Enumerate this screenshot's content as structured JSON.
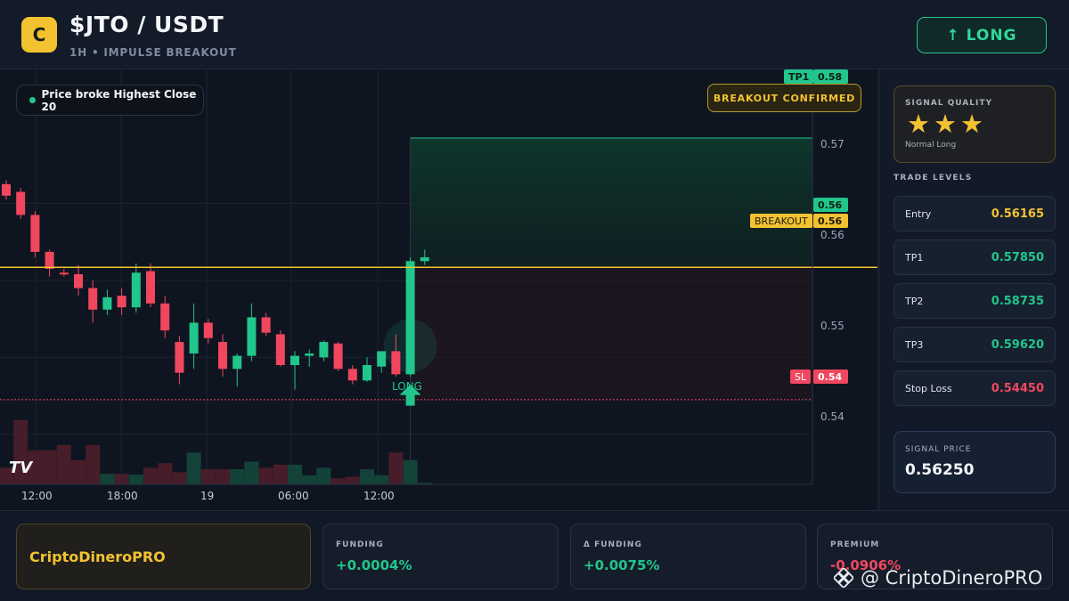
{
  "header": {
    "logo_letter": "C",
    "title": "$JTO / USDT",
    "subtitle": "1H • IMPULSE BREAKOUT",
    "long_button": "↑ LONG"
  },
  "chart": {
    "info_pill": "Price broke Highest Close 20",
    "confirmed_pill": "BREAKOUT CONFIRMED",
    "long_marker": "LONG",
    "tv_logo": "TV",
    "tags": {
      "tp1_label": "TP1",
      "tp1_value": "0.58",
      "last_value": "0.56",
      "breakout_label": "BREAKOUT",
      "breakout_value": "0.56",
      "sl_label": "SL",
      "sl_value": "0.54"
    },
    "price_axis": [
      "0.57",
      "0.56",
      "0.55",
      "0.54"
    ],
    "time_axis": [
      "12:00",
      "18:00",
      "19",
      "06:00",
      "12:00"
    ],
    "colors": {
      "up": "#22c58b",
      "down": "#f0475f",
      "breakout": "#f2c230",
      "sl": "#f0475f"
    }
  },
  "chart_data": {
    "type": "candlestick",
    "ylim": [
      0.5335,
      0.5874
    ],
    "candles": [
      {
        "o": 0.5725,
        "h": 0.573,
        "l": 0.5705,
        "c": 0.571
      },
      {
        "o": 0.5715,
        "h": 0.572,
        "l": 0.568,
        "c": 0.5685
      },
      {
        "o": 0.5685,
        "h": 0.569,
        "l": 0.563,
        "c": 0.5637
      },
      {
        "o": 0.5637,
        "h": 0.564,
        "l": 0.5605,
        "c": 0.5615
      },
      {
        "o": 0.561,
        "h": 0.5615,
        "l": 0.5605,
        "c": 0.5608
      },
      {
        "o": 0.5608,
        "h": 0.562,
        "l": 0.558,
        "c": 0.559
      },
      {
        "o": 0.559,
        "h": 0.56,
        "l": 0.5545,
        "c": 0.5562
      },
      {
        "o": 0.5562,
        "h": 0.5588,
        "l": 0.5555,
        "c": 0.5578
      },
      {
        "o": 0.558,
        "h": 0.559,
        "l": 0.5555,
        "c": 0.5565
      },
      {
        "o": 0.5565,
        "h": 0.5622,
        "l": 0.5558,
        "c": 0.561
      },
      {
        "o": 0.5612,
        "h": 0.5622,
        "l": 0.5565,
        "c": 0.557
      },
      {
        "o": 0.557,
        "h": 0.558,
        "l": 0.5525,
        "c": 0.5535
      },
      {
        "o": 0.552,
        "h": 0.5528,
        "l": 0.5465,
        "c": 0.548
      },
      {
        "o": 0.5505,
        "h": 0.557,
        "l": 0.5485,
        "c": 0.5545
      },
      {
        "o": 0.5545,
        "h": 0.555,
        "l": 0.5518,
        "c": 0.5525
      },
      {
        "o": 0.552,
        "h": 0.553,
        "l": 0.5475,
        "c": 0.5485
      },
      {
        "o": 0.5485,
        "h": 0.5505,
        "l": 0.5462,
        "c": 0.5502
      },
      {
        "o": 0.5502,
        "h": 0.557,
        "l": 0.5495,
        "c": 0.5552
      },
      {
        "o": 0.5552,
        "h": 0.5558,
        "l": 0.5528,
        "c": 0.5532
      },
      {
        "o": 0.553,
        "h": 0.5535,
        "l": 0.5488,
        "c": 0.549
      },
      {
        "o": 0.549,
        "h": 0.5508,
        "l": 0.5458,
        "c": 0.5502
      },
      {
        "o": 0.5502,
        "h": 0.551,
        "l": 0.5488,
        "c": 0.5505
      },
      {
        "o": 0.55,
        "h": 0.5522,
        "l": 0.5495,
        "c": 0.552
      },
      {
        "o": 0.5518,
        "h": 0.552,
        "l": 0.5482,
        "c": 0.5485
      },
      {
        "o": 0.5485,
        "h": 0.549,
        "l": 0.5465,
        "c": 0.547
      },
      {
        "o": 0.547,
        "h": 0.55,
        "l": 0.5468,
        "c": 0.549
      },
      {
        "o": 0.5488,
        "h": 0.5508,
        "l": 0.548,
        "c": 0.5508
      },
      {
        "o": 0.5508,
        "h": 0.553,
        "l": 0.5475,
        "c": 0.5478
      },
      {
        "o": 0.5478,
        "h": 0.563,
        "l": 0.5475,
        "c": 0.5625
      },
      {
        "o": 0.5625,
        "h": 0.564,
        "l": 0.562,
        "c": 0.563
      }
    ],
    "volume": [
      0.22,
      0.85,
      0.45,
      0.45,
      0.52,
      0.32,
      0.52,
      0.14,
      0.14,
      0.13,
      0.22,
      0.28,
      0.16,
      0.42,
      0.2,
      0.2,
      0.2,
      0.3,
      0.22,
      0.26,
      0.26,
      0.12,
      0.22,
      0.08,
      0.1,
      0.2,
      0.12,
      0.42,
      0.32,
      0.02
    ],
    "levels": {
      "tp1": 0.5785,
      "breakout": 0.5617,
      "sl": 0.5445
    }
  },
  "side": {
    "quality_label": "SIGNAL QUALITY",
    "quality_stars": 3,
    "quality_sub": "Normal Long",
    "levels_title": "TRADE LEVELS",
    "levels": [
      {
        "name": "Entry",
        "value": "0.56165",
        "color": "#f2c230"
      },
      {
        "name": "TP1",
        "value": "0.57850",
        "color": "#22c58b"
      },
      {
        "name": "TP2",
        "value": "0.58735",
        "color": "#22c58b"
      },
      {
        "name": "TP3",
        "value": "0.59620",
        "color": "#22c58b"
      },
      {
        "name": "Stop Loss",
        "value": "0.54450",
        "color": "#f0475f"
      }
    ],
    "signal_price_label": "SIGNAL PRICE",
    "signal_price_value": "0.56250"
  },
  "footer": {
    "brand": "CriptoDineroPRO",
    "funding_label": "FUNDING",
    "funding_value": "+0.0004%",
    "delta_funding_label": "Δ FUNDING",
    "delta_funding_value": "+0.0075%",
    "premium_label": "PREMIUM",
    "premium_value": "-0.0906%",
    "watermark": "@ CriptoDineroPRO"
  }
}
